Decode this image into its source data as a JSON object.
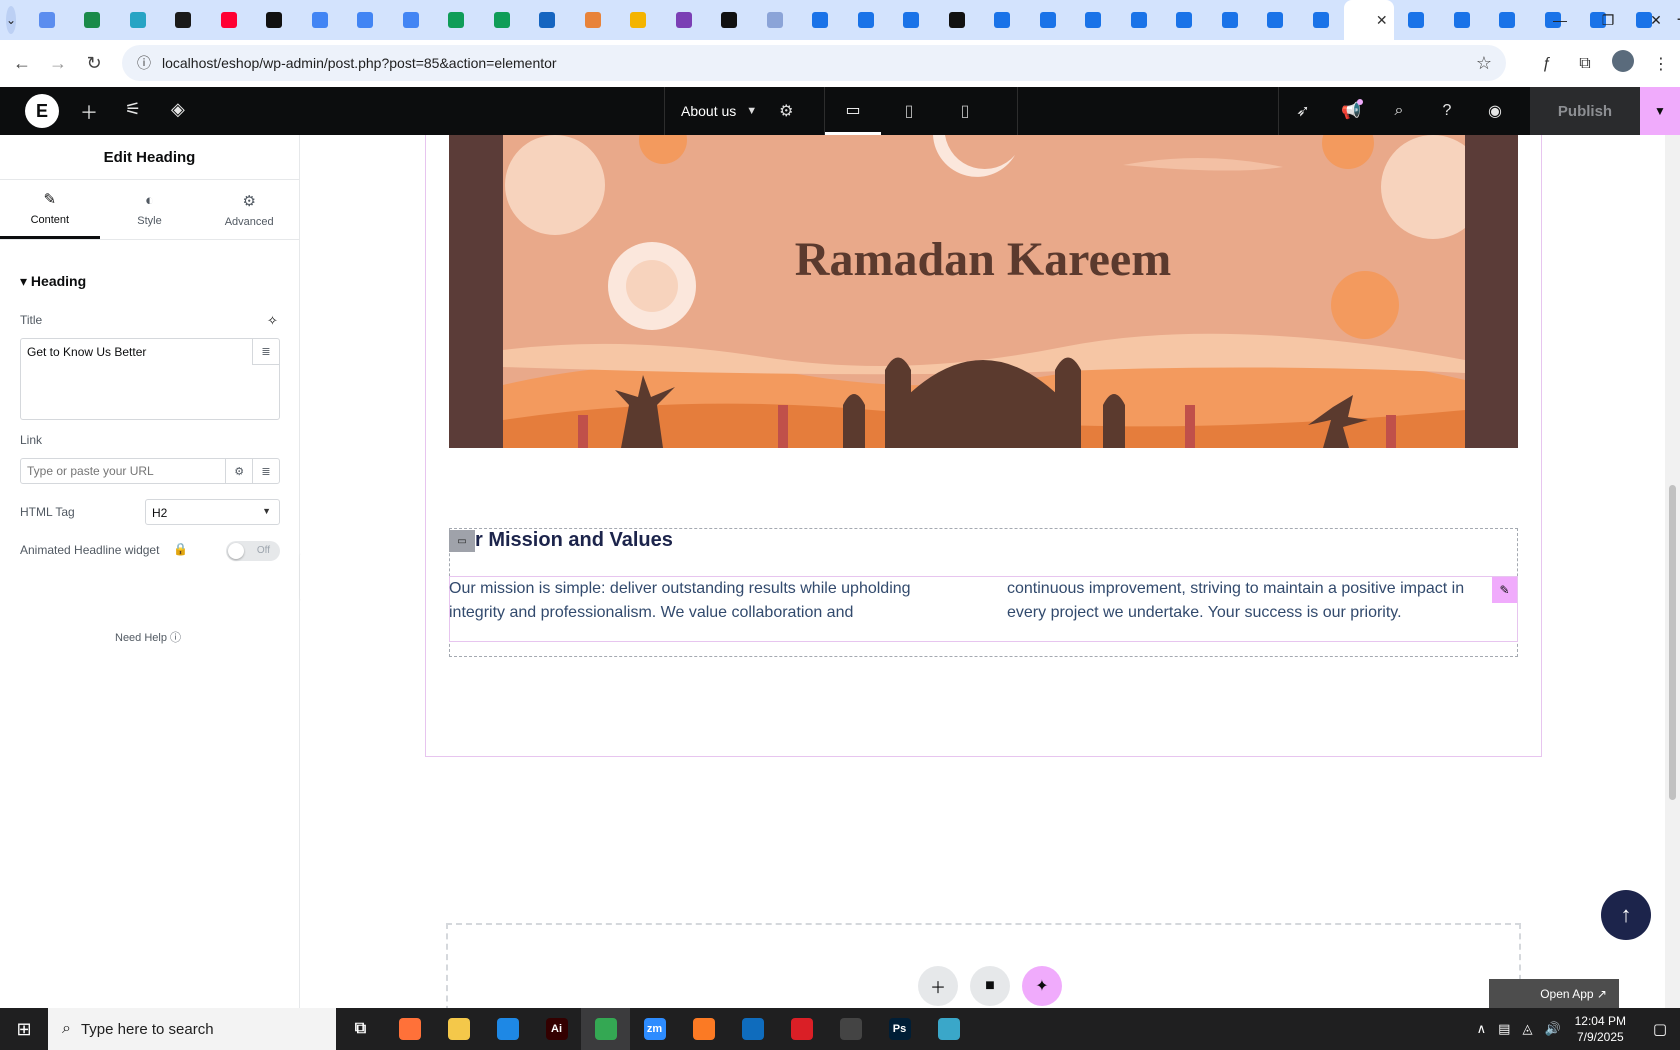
{
  "browser": {
    "active_tab_close": "✕",
    "new_tab": "+",
    "url": "localhost/eshop/wp-admin/post.php?post=85&action=elementor",
    "favicon_colors": [
      "#5b8def",
      "#1a8a4a",
      "#27a4c4",
      "#1a1a1a",
      "#ff0033",
      "#111111",
      "#4285f4",
      "#4285f4",
      "#4285f4",
      "#0f9d58",
      "#0f9d58",
      "#1565c0",
      "#e8833a",
      "#f4b400",
      "#7b3fb5",
      "#111111",
      "#8ba4d8",
      "#1a73e8",
      "#1a73e8",
      "#1a73e8",
      "#111111",
      "#1a73e8",
      "#1a73e8",
      "#1a73e8",
      "#1a73e8",
      "#1a73e8",
      "#1a73e8",
      "#1a73e8",
      "#1a73e8",
      "#1a73e8",
      "#1a73e8",
      "#1a73e8",
      "#1a73e8",
      "#1a73e8",
      "#1a73e8"
    ]
  },
  "elementor": {
    "page_name": "About us",
    "publish_label": "Publish",
    "accent": "#f0abfc"
  },
  "panel": {
    "title": "Edit Heading",
    "tabs": [
      {
        "label": "Content",
        "icon": "pencil-icon"
      },
      {
        "label": "Style",
        "icon": "half-circle-icon"
      },
      {
        "label": "Advanced",
        "icon": "gear-icon"
      }
    ],
    "section": "Heading",
    "title_label": "Title",
    "title_value": "Get to Know Us Better",
    "link_label": "Link",
    "link_placeholder": "Type or paste your URL",
    "html_tag_label": "HTML Tag",
    "html_tag_value": "H2",
    "animated_label": "Animated Headline widget",
    "toggle_state": "Off",
    "need_help": "Need Help"
  },
  "canvas": {
    "banner_title": "Ramadan Kareem",
    "mission_heading": "r Mission and Values",
    "col1_line1": "Our mission is simple: deliver outstanding results while upholding",
    "col1_line2": "integrity and professionalism. We value collaboration and",
    "col2_line1": "continuous improvement, striving to maintain a positive impact in",
    "col2_line2": "every project we undertake. Your success is our priority.",
    "open_app": "Open App ↗"
  },
  "taskbar": {
    "search_placeholder": "Type here to search",
    "time": "12:04 PM",
    "date": "7/9/2025",
    "apps": [
      {
        "name": "firefox",
        "color": "#ff7139",
        "txt": ""
      },
      {
        "name": "file-explorer",
        "color": "#f4c84a",
        "txt": ""
      },
      {
        "name": "vscode",
        "color": "#1e88e5",
        "txt": ""
      },
      {
        "name": "illustrator",
        "color": "#330000",
        "txt": "Ai"
      },
      {
        "name": "chrome",
        "color": "#34a853",
        "txt": ""
      },
      {
        "name": "zoom",
        "color": "#2d8cff",
        "txt": "zm"
      },
      {
        "name": "xampp",
        "color": "#fb7a24",
        "txt": ""
      },
      {
        "name": "outlook",
        "color": "#0f6cbd",
        "txt": ""
      },
      {
        "name": "creative-cloud",
        "color": "#da1f26",
        "txt": ""
      },
      {
        "name": "pen-tool",
        "color": "#444444",
        "txt": ""
      },
      {
        "name": "photoshop",
        "color": "#001e36",
        "txt": "Ps"
      },
      {
        "name": "app-gem",
        "color": "#3aa7c9",
        "txt": ""
      }
    ]
  }
}
